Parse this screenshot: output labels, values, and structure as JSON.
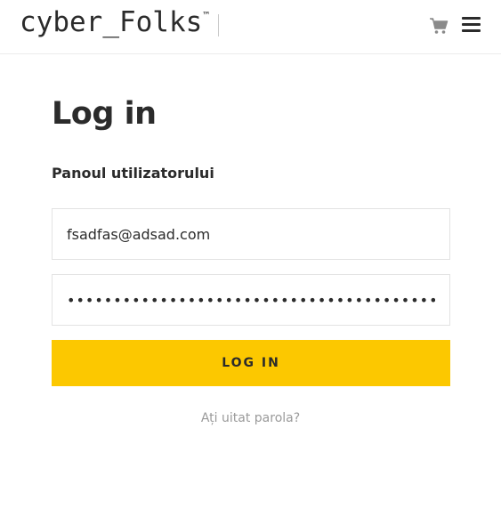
{
  "header": {
    "logo_text": "cyber_Folks",
    "logo_tm": "™",
    "cart_icon": "shopping-cart",
    "menu_icon": "hamburger-menu"
  },
  "main": {
    "title": "Log in",
    "subtitle": "Panoul utilizatorului",
    "email_value": "fsadfas@adsad.com",
    "password_value": "••••••••••••••••••••••••••••••••••••••••••",
    "login_button_label": "LOG IN",
    "forgot_password_link": "Ați uitat parola?"
  },
  "colors": {
    "accent": "#fcc800",
    "text": "#2b2b2b",
    "muted": "#9a9a9a",
    "border": "#e3e3e3"
  }
}
